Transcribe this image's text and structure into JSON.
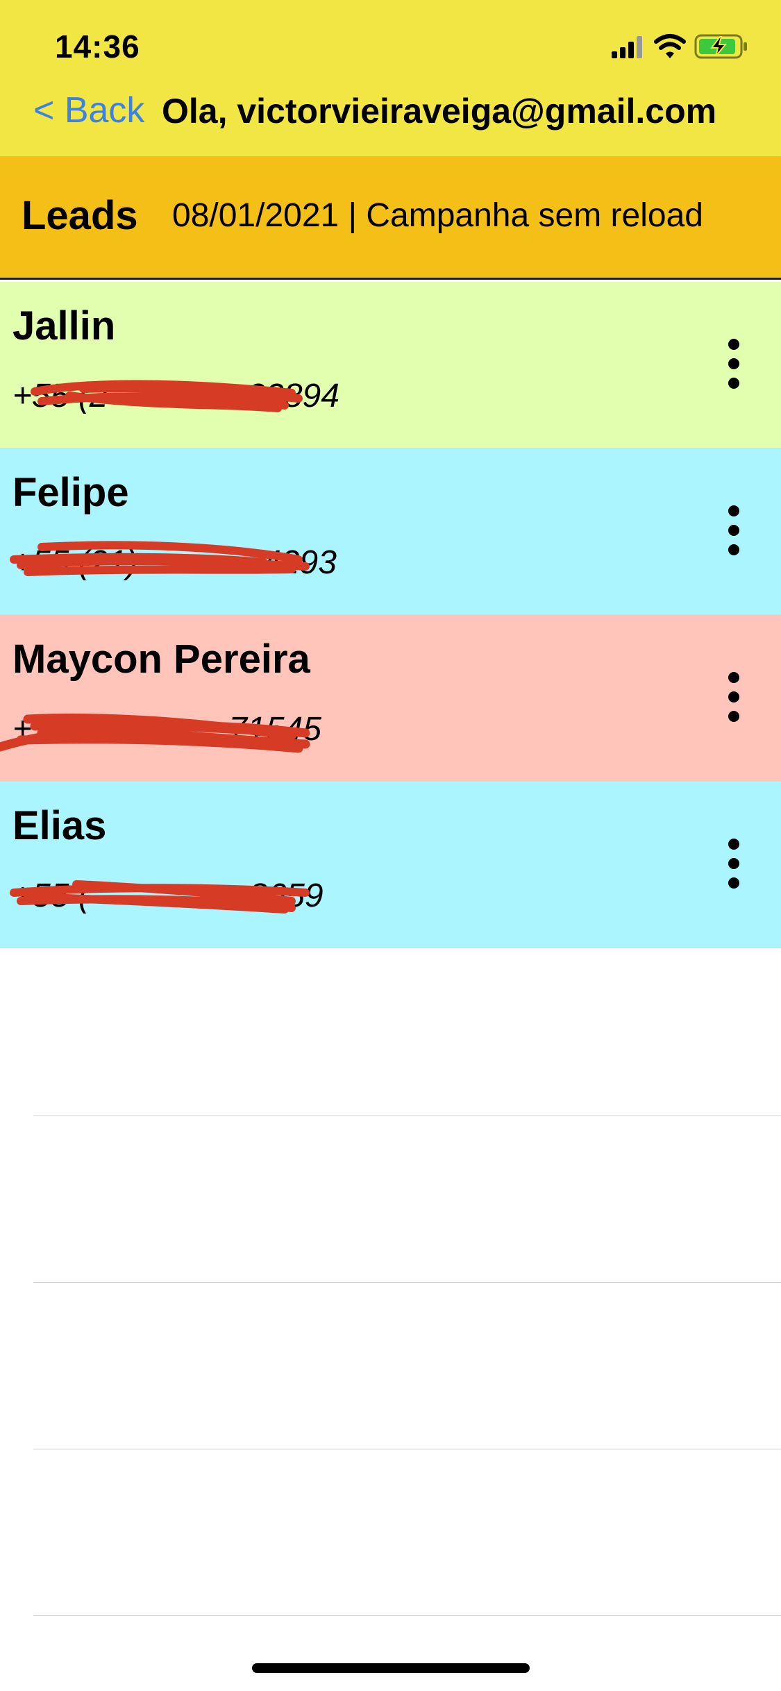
{
  "status_bar": {
    "time": "14:36",
    "icons": [
      "signal-icon",
      "wifi-icon",
      "battery-charging-icon"
    ]
  },
  "nav": {
    "back_label": "< Back",
    "title": "Ola, victorvieiraveiga@gmail.com"
  },
  "header": {
    "title": "Leads",
    "subtitle": "08/01/2021 | Campanha sem reload"
  },
  "colors": {
    "status_bar_bg": "#F2E644",
    "header_bg": "#F4BF16",
    "back_link": "#3B82E8",
    "redaction": "#D63C25"
  },
  "leads": [
    {
      "name": "Jallin",
      "phone_visible": "+55 (2",
      "phone_tail": "33894",
      "bg": "#E1FFAE"
    },
    {
      "name": "Felipe",
      "phone_visible": "+55 (21)",
      "phone_tail": "4293",
      "bg": "#AAF5FF"
    },
    {
      "name": "Maycon Pereira",
      "phone_visible": "+55",
      "phone_tail": "71545",
      "bg": "#FFC5BA"
    },
    {
      "name": "Elias",
      "phone_visible": "+55 (",
      "phone_tail": "8659",
      "bg": "#AAF5FF"
    }
  ]
}
